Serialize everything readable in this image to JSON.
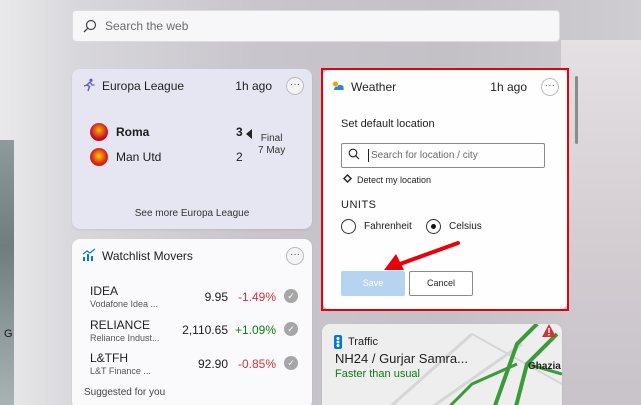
{
  "search": {
    "placeholder": "Search the web"
  },
  "europa": {
    "title": "Europa League",
    "time": "1h ago",
    "more": "···",
    "teams": [
      {
        "name": "Roma",
        "score": "3",
        "winner": true
      },
      {
        "name": "Man Utd",
        "score": "2",
        "winner": false
      }
    ],
    "status_line1": "Final",
    "status_line2": "7 May",
    "see_more": "See more Europa League"
  },
  "watchlist": {
    "title": "Watchlist Movers",
    "more": "···",
    "stocks": [
      {
        "symbol": "IDEA",
        "company": "Vodafone Idea ...",
        "price": "9.95",
        "change": "-1.49%",
        "direction": "down"
      },
      {
        "symbol": "RELIANCE",
        "company": "Reliance Indust...",
        "price": "2,110.65",
        "change": "+1.09%",
        "direction": "up"
      },
      {
        "symbol": "L&TFH",
        "company": "L&T Finance ...",
        "price": "92.90",
        "change": "-0.85%",
        "direction": "down"
      }
    ],
    "suggested": "Suggested for you",
    "check_glyph": "✓"
  },
  "weather": {
    "title": "Weather",
    "time": "1h ago",
    "more": "···",
    "set_location_label": "Set default location",
    "location_placeholder": "Search for location / city",
    "detect_label": "Detect my location",
    "units_label": "UNITS",
    "unit_options": [
      {
        "label": "Fahrenheit",
        "selected": false
      },
      {
        "label": "Celsius",
        "selected": true
      }
    ],
    "save_label": "Save",
    "cancel_label": "Cancel"
  },
  "traffic": {
    "title": "Traffic",
    "road": "NH24 / Gurjar Samra...",
    "status": "Faster than usual",
    "map_label": "Ghazia"
  },
  "background": {
    "left_letter": "G"
  },
  "colors": {
    "highlight": "#e8000b",
    "negative": "#d13438",
    "positive": "#107c10",
    "save_disabled": "#b6d3ef"
  },
  "icons": {
    "search": "search-icon",
    "europa": "runner-icon",
    "weather": "cloud-sun-icon",
    "watchlist": "stock-chart-icon",
    "traffic": "traffic-light-icon",
    "detect": "location-diamond-icon",
    "warning": "warning-icon"
  }
}
